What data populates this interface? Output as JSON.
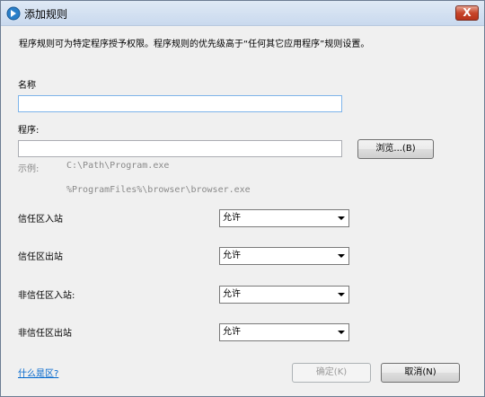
{
  "window": {
    "title": "添加规则",
    "close_label": "X"
  },
  "description": "程序规则可为特定程序授予权限。程序规则的优先级高于“任何其它应用程序”规则设置。",
  "name": {
    "label": "名称",
    "value": ""
  },
  "program": {
    "label": "程序:",
    "value": "",
    "browse_label": "浏览...(B)"
  },
  "example": {
    "label": "示例:",
    "path1": "C:\\Path\\Program.exe",
    "path2": "%ProgramFiles%\\browser\\browser.exe"
  },
  "rules": [
    {
      "label": "信任区入站",
      "value": "允许"
    },
    {
      "label": "信任区出站",
      "value": "允许"
    },
    {
      "label": "非信任区入站:",
      "value": "允许"
    },
    {
      "label": "非信任区出站",
      "value": "允许"
    }
  ],
  "footer": {
    "help_link": "什么是区?",
    "ok_label": "确定(K)",
    "cancel_label": "取消(N)"
  }
}
